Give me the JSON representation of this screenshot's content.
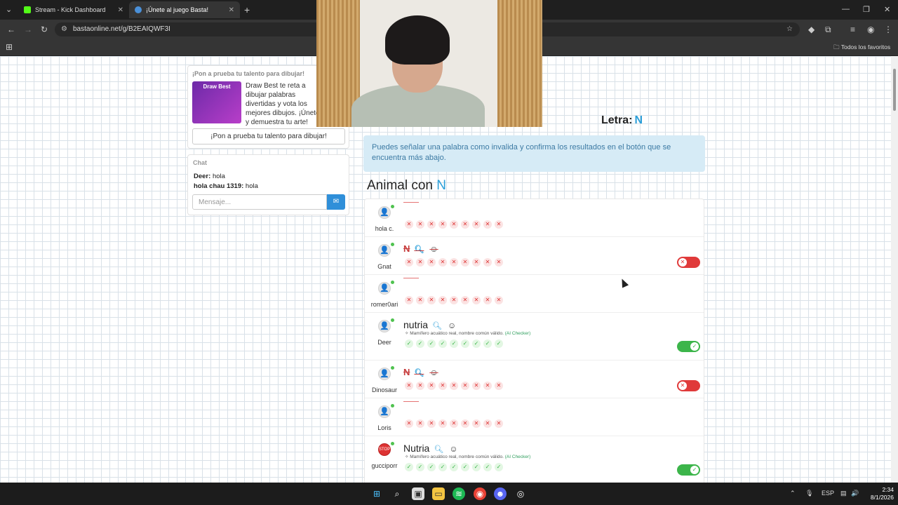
{
  "browser": {
    "tabs": [
      {
        "title": "Stream - Kick Dashboard",
        "favicon_color": "#53fc18"
      },
      {
        "title": "¡Únete al juego Basta!",
        "favicon_color": "#4a90d9"
      }
    ],
    "url": "bastaonline.net/g/B2EAIQWF3I",
    "bookmarks_label": "Todos los favoritos"
  },
  "promo": {
    "title": "¡Pon a prueba tu talento para dibujar!",
    "image_label": "Draw Best",
    "text": "Draw Best te reta a dibujar palabras divertidas y vota los mejores dibujos. ¡Únete y demuestra tu arte!",
    "button": "¡Pon a prueba tu talento para dibujar!"
  },
  "chat": {
    "title": "Chat",
    "messages": [
      {
        "user": "Deer:",
        "text": "hola"
      },
      {
        "user": "hola chau 1319:",
        "text": "hola"
      }
    ],
    "placeholder": "Mensaje...",
    "send_icon": "message-icon"
  },
  "game": {
    "letra_label": "Letra:",
    "letter": "N",
    "info": "Puedes señalar una palabra como invalida y confirma los resultados en el botón que se encuentra más abajo.",
    "category": "Animal con",
    "answers": [
      {
        "user": "hola c.",
        "word": "",
        "type": "empty",
        "valid": false,
        "toggle": null
      },
      {
        "user": "Gnat",
        "word": "N",
        "type": "strike",
        "valid": false,
        "toggle": "off"
      },
      {
        "user": "romer0ari",
        "word": "",
        "type": "empty",
        "valid": false,
        "toggle": null
      },
      {
        "user": "Deer",
        "word": "nutria",
        "type": "word",
        "valid": true,
        "toggle": "on",
        "note": "Mamífero acuático real, nombre común válido.",
        "ai": "(AI Checker)"
      },
      {
        "user": "Dinosaur",
        "word": "N",
        "type": "strike",
        "valid": false,
        "toggle": "off"
      },
      {
        "user": "Loris",
        "word": "",
        "type": "empty",
        "valid": false,
        "toggle": null
      },
      {
        "user": "gucciporr",
        "word": "Nutria",
        "type": "word",
        "valid": true,
        "toggle": "on",
        "note": "Mamífero acuático real, nombre común válido.",
        "ai": "(AI Checker)",
        "avatar": "stop"
      }
    ],
    "mark_count": 9
  },
  "taskbar": {
    "lang": "ESP",
    "time": "2:34",
    "date": "8/1/2026"
  }
}
